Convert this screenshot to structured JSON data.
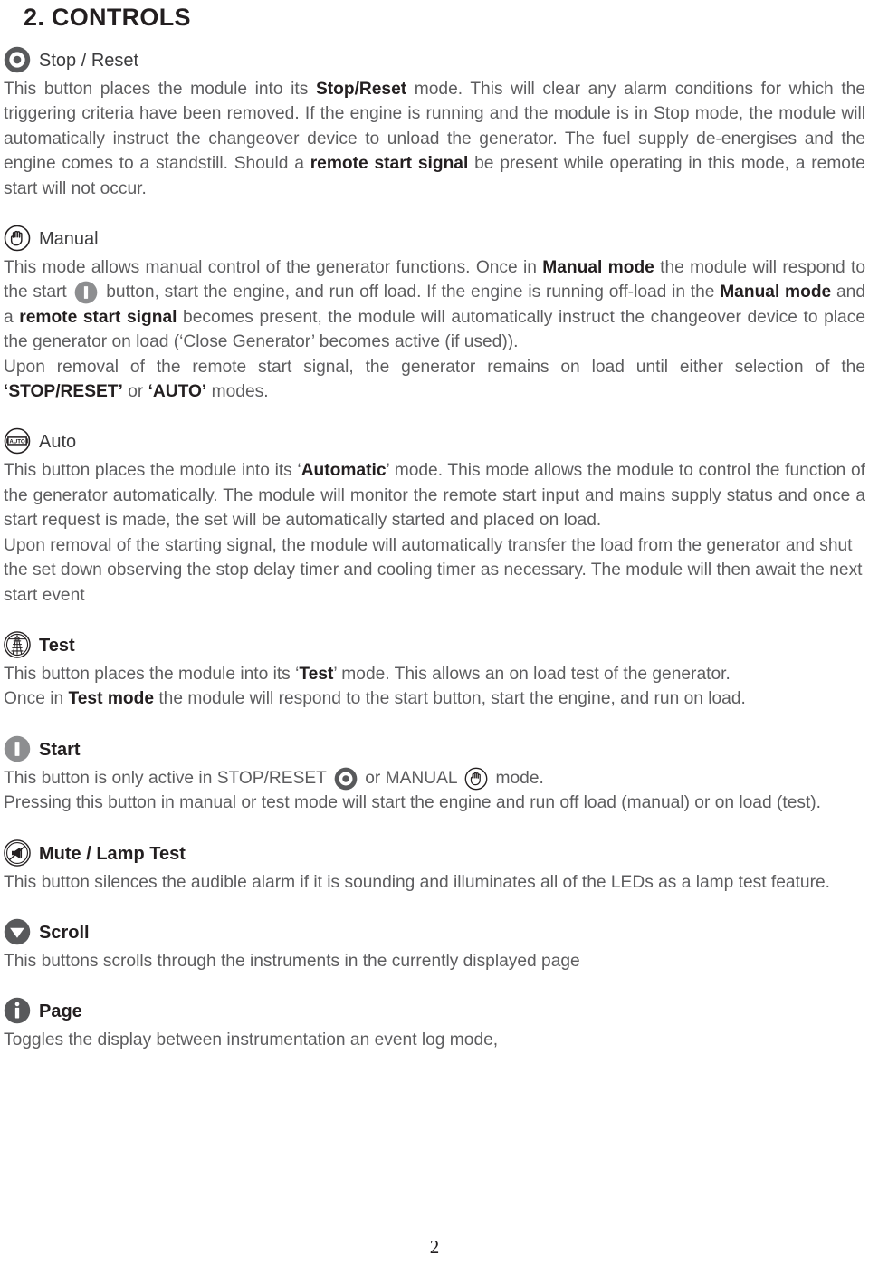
{
  "document": {
    "title": "2. CONTROLS",
    "page_number": "2"
  },
  "colors": {
    "body_text": "#5d5d5f",
    "heading_text": "#231f20",
    "icon_dark": "#58595b",
    "icon_outline": "#231f20",
    "icon_grey": "#8d8e90",
    "page_background": "#ffffff"
  },
  "sections": [
    {
      "id": "stop-reset",
      "icon": "stop-reset-icon",
      "label": "Stop / Reset",
      "label_bold": false,
      "paragraphs": [
        {
          "id": "stop-reset-p1",
          "runs": [
            {
              "t": "This button places the module into its ",
              "b": false
            },
            {
              "t": "Stop/Reset",
              "b": true
            },
            {
              "t": " mode. This will clear any alarm conditions for which the triggering criteria have been removed. If the engine is running and the module is in Stop mode, the module will automatically instruct the changeover device to unload the generator. The fuel supply de-energises and the engine comes to a standstill. Should a ",
              "b": false
            },
            {
              "t": "remote start signal",
              "b": true
            },
            {
              "t": " be present while operating in this mode, a remote start will not occur.",
              "b": false
            }
          ]
        }
      ]
    },
    {
      "id": "manual",
      "icon": "manual-icon",
      "label": "Manual",
      "label_bold": false,
      "paragraphs": [
        {
          "id": "manual-p1",
          "runs": [
            {
              "t": "This mode allows manual control of the generator functions. Once in ",
              "b": false
            },
            {
              "t": "Manual mode",
              "b": true
            },
            {
              "t": " the module will respond to the start ",
              "b": false
            },
            {
              "icon": "start-icon-inline"
            },
            {
              "t": " button, start the engine, and run off load. If the engine is running off-load in the ",
              "b": false
            },
            {
              "t": "Manual mode",
              "b": true
            },
            {
              "t": " and a ",
              "b": false
            },
            {
              "t": "remote start signal",
              "b": true
            },
            {
              "t": " becomes present, the module will automatically instruct the changeover device to place the generator on load (‘Close Generator’ becomes active (if used)).",
              "b": false
            }
          ]
        },
        {
          "id": "manual-p2",
          "runs": [
            {
              "t": "Upon removal of the remote start signal, the generator remains on load until either selection of the ",
              "b": false
            },
            {
              "t": "‘STOP/RESET’",
              "b": true
            },
            {
              "t": " or ",
              "b": false
            },
            {
              "t": "‘AUTO’",
              "b": true
            },
            {
              "t": " modes.",
              "b": false
            }
          ]
        }
      ]
    },
    {
      "id": "auto",
      "icon": "auto-icon",
      "icon_text": "AUTO",
      "label": "Auto",
      "label_bold": false,
      "paragraphs": [
        {
          "id": "auto-p1",
          "runs": [
            {
              "t": "This button places the module into its ‘",
              "b": false
            },
            {
              "t": "Automatic",
              "b": true
            },
            {
              "t": "’ mode. This mode allows the module to control the function of the generator automatically. The module will monitor the remote start input and mains supply status and once a start request is made, the set will be automatically started and placed on load.",
              "b": false
            }
          ]
        },
        {
          "id": "auto-p2",
          "runs": [
            {
              "t": "Upon removal of the starting signal, the module will automatically transfer the load from the generator and shut the set down observing the stop delay timer and cooling timer as necessary. The module will then await the next start event",
              "b": false
            }
          ]
        }
      ]
    },
    {
      "id": "test",
      "icon": "test-icon",
      "label": "Test",
      "label_bold": true,
      "paragraphs": [
        {
          "id": "test-p1",
          "runs": [
            {
              "t": "This button places the module into its ‘",
              "b": false
            },
            {
              "t": "Test",
              "b": true
            },
            {
              "t": "’ mode. This allows an on load test of the generator.",
              "b": false
            }
          ]
        },
        {
          "id": "test-p2",
          "runs": [
            {
              "t": "Once in ",
              "b": false
            },
            {
              "t": "Test mode",
              "b": true
            },
            {
              "t": " the module will respond to the start button, start the engine, and run on load.",
              "b": false
            }
          ]
        }
      ]
    },
    {
      "id": "start",
      "icon": "start-icon",
      "label": "Start",
      "label_bold": true,
      "paragraphs": [
        {
          "id": "start-p1",
          "runs": [
            {
              "t": "This button is only active in STOP/RESET ",
              "b": false
            },
            {
              "icon": "stop-reset-icon-inline"
            },
            {
              "t": " or MANUAL ",
              "b": false
            },
            {
              "icon": "manual-icon-inline"
            },
            {
              "t": " mode.",
              "b": false
            }
          ]
        },
        {
          "id": "start-p2",
          "runs": [
            {
              "t": "Pressing this button in manual or test mode will start the engine and run off load (manual) or on load (test).",
              "b": false
            }
          ]
        }
      ]
    },
    {
      "id": "mute-lamp-test",
      "icon": "mute-lamp-test-icon",
      "label": "Mute / Lamp Test",
      "label_bold": true,
      "paragraphs": [
        {
          "id": "mute-p1",
          "runs": [
            {
              "t": "This button silences the audible alarm if it is sounding and illuminates all of the LEDs as a lamp test feature.",
              "b": false
            }
          ]
        }
      ]
    },
    {
      "id": "scroll",
      "icon": "scroll-icon",
      "label": "Scroll",
      "label_bold": true,
      "paragraphs": [
        {
          "id": "scroll-p1",
          "runs": [
            {
              "t": "This buttons scrolls through the instruments in the currently displayed page",
              "b": false
            }
          ]
        }
      ]
    },
    {
      "id": "page",
      "icon": "page-info-icon",
      "label": "Page",
      "label_bold": true,
      "paragraphs": [
        {
          "id": "page-p1",
          "runs": [
            {
              "t": "Toggles the display between instrumentation an event log mode,",
              "b": false
            }
          ]
        }
      ]
    }
  ]
}
